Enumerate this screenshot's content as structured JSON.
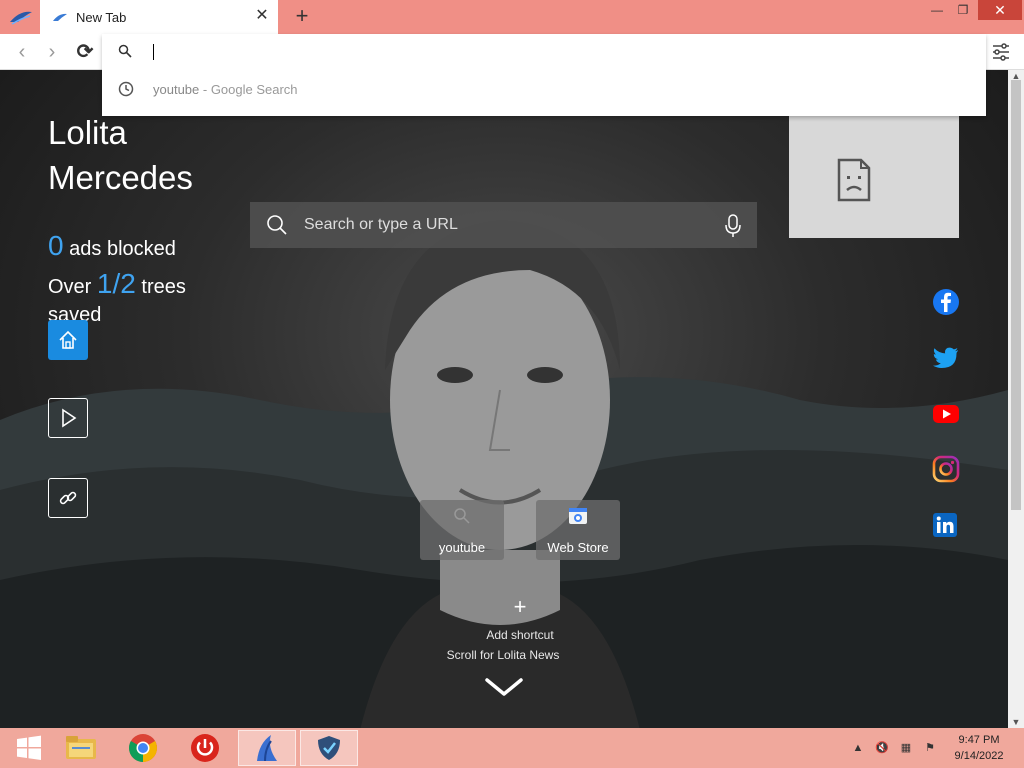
{
  "tab": {
    "title": "New Tab"
  },
  "omnibox": {
    "value": "",
    "suggestion_query": "youtube",
    "suggestion_source": " - Google Search"
  },
  "brand": {
    "name_line1": "Lolita",
    "name_line2": "Mercedes"
  },
  "stats": {
    "ads_count": "0",
    "ads_label": "ads blocked",
    "trees_prefix": "Over",
    "trees_count": "1/2",
    "trees_label": "trees saved"
  },
  "search": {
    "placeholder": "Search or type a URL"
  },
  "shortcuts": [
    {
      "label": "youtube",
      "icon": "search-icon"
    },
    {
      "label": "Web Store",
      "icon": "web-store-icon"
    }
  ],
  "add_shortcut_label": "Add shortcut",
  "news_label": "Scroll for Lolita News",
  "social": [
    "facebook",
    "twitter",
    "youtube",
    "instagram",
    "linkedin"
  ],
  "taskbar": {
    "time": "9:47 PM",
    "date": "9/14/2022",
    "apps": [
      "start",
      "file-explorer",
      "chrome",
      "power",
      "lolita-browser",
      "vpn-shield"
    ]
  },
  "colors": {
    "tabbar": "#f08f86",
    "accent_blue": "#3fa3f0",
    "home_button": "#1a8be0",
    "taskbar": "#f0a89c"
  }
}
